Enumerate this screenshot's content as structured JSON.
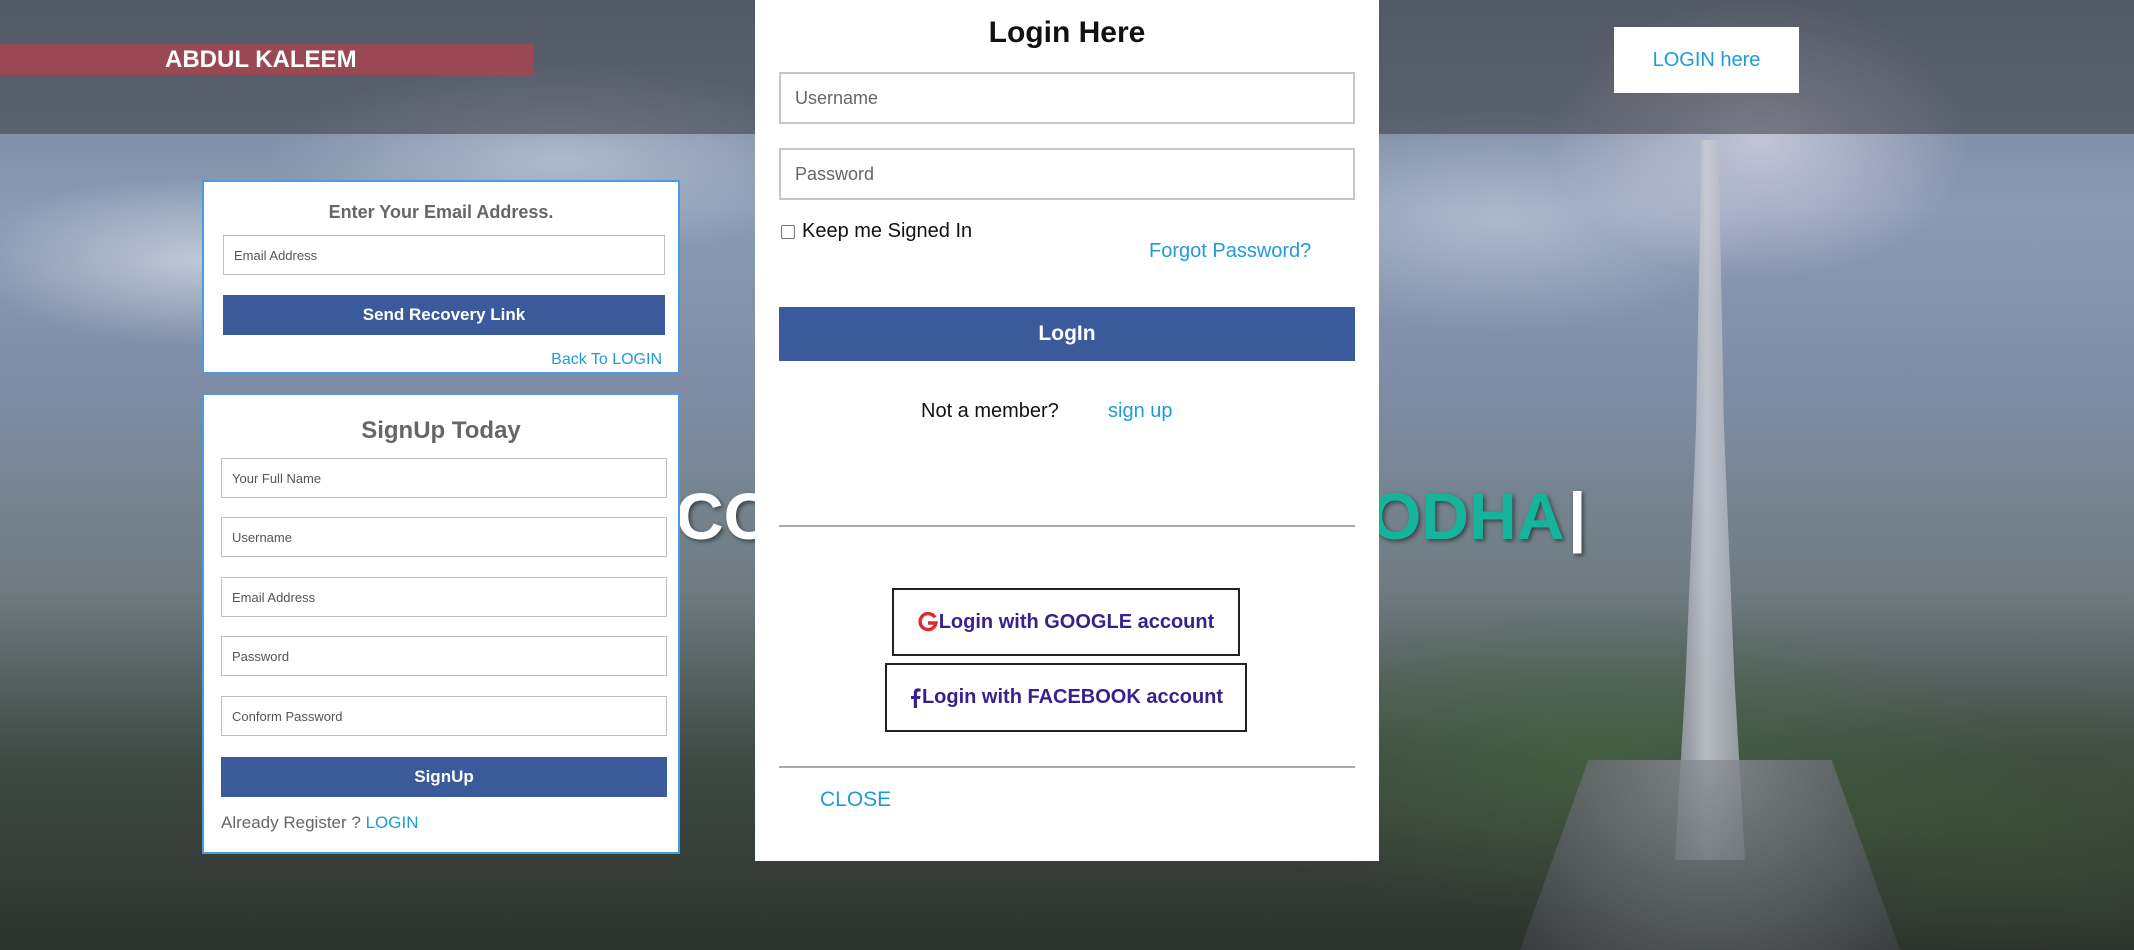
{
  "header": {
    "brand": "ABDUL KALEEM",
    "login_button": "LOGIN here"
  },
  "headline": {
    "left_fragment": "CO",
    "right_fragment": "ODHA",
    "cursor": "|"
  },
  "recovery": {
    "title": "Enter Your Email Address.",
    "email_placeholder": "Email Address",
    "send_button": "Send Recovery Link",
    "back_link": "Back To LOGIN"
  },
  "signup": {
    "title": "SignUp Today",
    "fields": [
      "Your Full Name",
      "Username",
      "Email Address",
      "Password",
      "Conform Password"
    ],
    "submit": "SignUp",
    "already_text": "Already Register ?",
    "login_link": "LOGIN"
  },
  "modal": {
    "heading": "Login Here",
    "username_placeholder": "Username",
    "password_placeholder": "Password",
    "keep_signed_in": "Keep me Signed In",
    "forgot_password": "Forgot Password?",
    "login_button": "LogIn",
    "not_member": "Not a member?",
    "signup_link": "sign up",
    "google_button": "Login with GOOGLE account",
    "facebook_button": "Login with FACEBOOK account",
    "close": "CLOSE"
  },
  "icons": {
    "google": "google-icon",
    "facebook": "facebook-icon"
  },
  "colors": {
    "primary_button": "#3a5a9c",
    "link": "#1e9cd7",
    "brand_bar": "#be3e48",
    "headline_accent": "#16b49b",
    "panel_border": "#4a9be3",
    "social_text": "#3a1f8f",
    "google_red": "#dd2c2c"
  }
}
